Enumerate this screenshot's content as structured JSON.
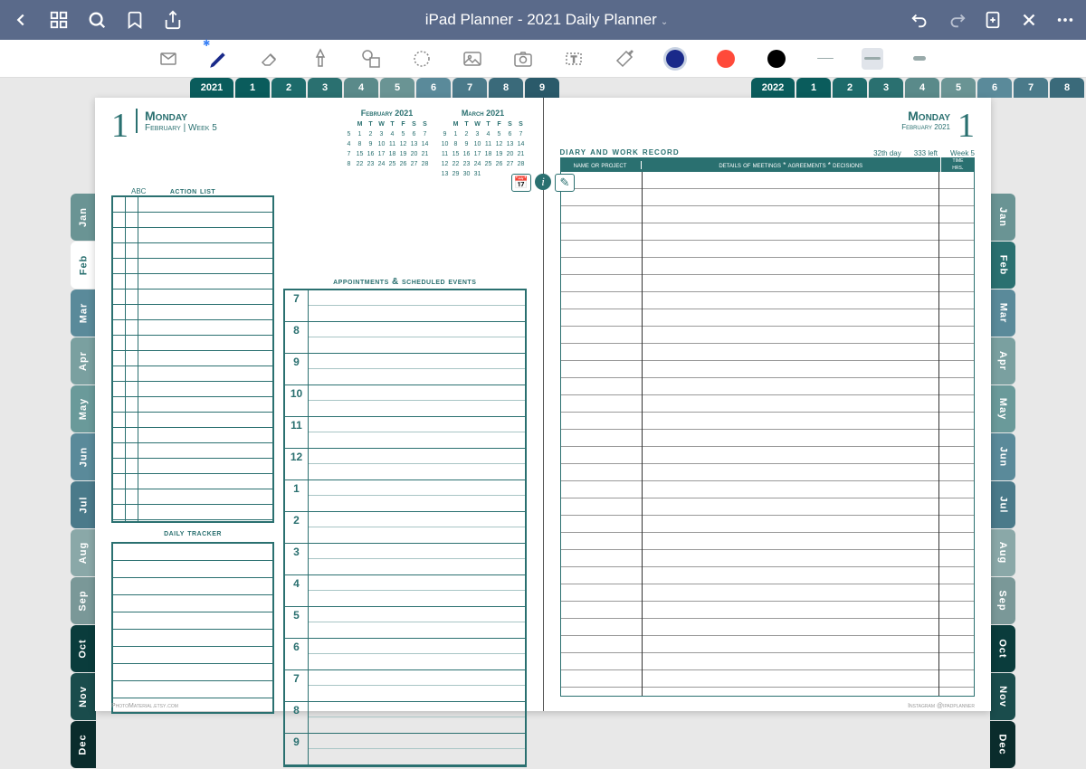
{
  "titlebar": {
    "title": "iPad Planner - 2021 Daily Planner"
  },
  "tabs": {
    "year_left": "2021",
    "year_right": "2022",
    "nums": [
      "1",
      "2",
      "3",
      "4",
      "5",
      "6",
      "7",
      "8",
      "9"
    ],
    "colors": [
      "#0a5c5c",
      "#1d6b6b",
      "#2a7070",
      "#5a8a8a",
      "#6a9494",
      "#5a8a9a",
      "#4a7a8a",
      "#3a6a7a",
      "#2a5a6a"
    ]
  },
  "months": {
    "labels": [
      "Jan",
      "Feb",
      "Mar",
      "Apr",
      "May",
      "Jun",
      "Jul",
      "Aug",
      "Sep",
      "Oct",
      "Nov",
      "Dec"
    ],
    "colors_left": [
      "#6a9494",
      "#ffffff",
      "#5a8a9a",
      "#7aa0a0",
      "#6a9a9a",
      "#5a8a9a",
      "#4a7a8a",
      "#8aa8a8",
      "#7a9898",
      "#0a3c3c",
      "#1a4c4c",
      "#0a2c2c"
    ],
    "colors_right": [
      "#6a9494",
      "#2a7070",
      "#5a8a9a",
      "#7aa0a0",
      "#6a9a9a",
      "#5a8a9a",
      "#4a7a8a",
      "#8aa8a8",
      "#7a9898",
      "#0a3c3c",
      "#1a4c4c",
      "#0a2c2c"
    ],
    "active_left": 1
  },
  "left_page": {
    "day_num": "1",
    "dow": "Monday",
    "month": "February",
    "week": "Week 5",
    "action_title": "action list",
    "abc": "ABC",
    "tracker_title": "daily tracker",
    "appt_title": "appointments & scheduled events",
    "hours": [
      "7",
      "8",
      "9",
      "10",
      "11",
      "12",
      "1",
      "2",
      "3",
      "4",
      "5",
      "6",
      "7",
      "8",
      "9"
    ],
    "footer": "PhotoMaterial.etsy.com"
  },
  "mini_cal": {
    "feb": {
      "title": "February 2021",
      "head": [
        "",
        "M",
        "T",
        "W",
        "T",
        "F",
        "S",
        "S"
      ],
      "rows": [
        [
          "5",
          "1",
          "2",
          "3",
          "4",
          "5",
          "6",
          "7"
        ],
        [
          "4",
          "8",
          "9",
          "10",
          "11",
          "12",
          "13",
          "14"
        ],
        [
          "7",
          "15",
          "16",
          "17",
          "18",
          "19",
          "20",
          "21"
        ],
        [
          "8",
          "22",
          "23",
          "24",
          "25",
          "26",
          "27",
          "28"
        ]
      ]
    },
    "mar": {
      "title": "March 2021",
      "head": [
        "",
        "M",
        "T",
        "W",
        "T",
        "F",
        "S",
        "S"
      ],
      "rows": [
        [
          "9",
          "1",
          "2",
          "3",
          "4",
          "5",
          "6",
          "7"
        ],
        [
          "10",
          "8",
          "9",
          "10",
          "11",
          "12",
          "13",
          "14"
        ],
        [
          "11",
          "15",
          "16",
          "17",
          "18",
          "19",
          "20",
          "21"
        ],
        [
          "12",
          "22",
          "23",
          "24",
          "25",
          "26",
          "27",
          "28"
        ],
        [
          "13",
          "29",
          "30",
          "31",
          "",
          "",
          "",
          ""
        ]
      ]
    }
  },
  "right_page": {
    "dow": "Monday",
    "month_year": "February 2021",
    "day_num": "1",
    "diary_title": "diary and work record",
    "day_nth": "32th day",
    "days_left": "333 left",
    "week": "Week 5",
    "col1": "name or project",
    "col2": "details of meetings * agreements * decisions",
    "col3": "time\nhrs.",
    "footer": "Instagram @ipadplanner"
  },
  "colors": {
    "blue": "#1a2a8a",
    "red": "#ff4a3a",
    "black": "#000000"
  }
}
